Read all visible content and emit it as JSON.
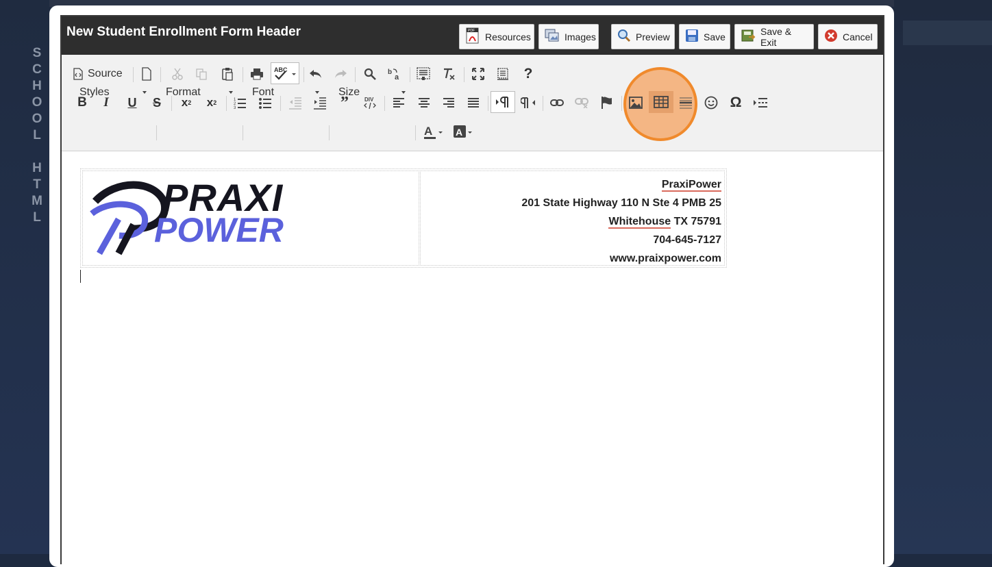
{
  "sidebar": {
    "brand_letters": [
      "S",
      "C",
      "H",
      "O",
      "O",
      "L",
      "",
      "H",
      "T",
      "M",
      "L"
    ]
  },
  "dialog": {
    "title": "New Student Enrollment Form Header",
    "buttons": {
      "resources": "Resources",
      "images": "Images",
      "preview": "Preview",
      "save": "Save",
      "save_exit": "Save & Exit",
      "cancel": "Cancel"
    }
  },
  "toolbar": {
    "source_label": "Source",
    "styles_label": "Styles",
    "format_label": "Format",
    "font_label": "Font",
    "size_label": "Size",
    "help_label": "?"
  },
  "document": {
    "logo": {
      "line1": "PRAXI",
      "line2": "POWER"
    },
    "company": "PraxiPower",
    "street": "201 State Highway 110 N Ste 4 PMB 25",
    "city": "Whitehouse",
    "state_zip": "TX 75791",
    "phone": "704-645-7127",
    "website": "www.praixpower.com"
  },
  "colors": {
    "logo_dark": "#15151f",
    "logo_accent": "#5b61dc",
    "highlight": "#f08a2c"
  }
}
